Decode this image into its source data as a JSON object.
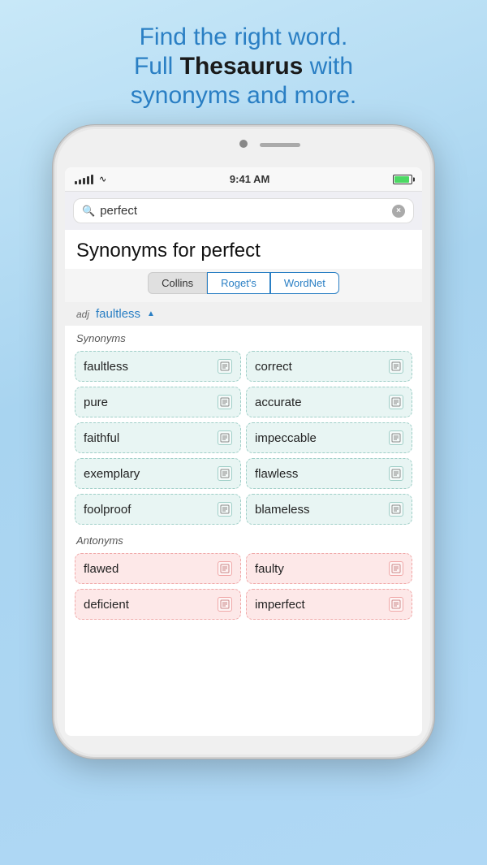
{
  "header": {
    "line1": "Find the right word.",
    "line2_plain": "Full ",
    "line2_bold": "Thesaurus",
    "line2_rest": " with",
    "line3": "synonyms and more."
  },
  "status_bar": {
    "time": "9:41 AM",
    "signal": "●●●●●",
    "wifi": "WiFi"
  },
  "search": {
    "placeholder": "Search",
    "value": "perfect",
    "clear_label": "×"
  },
  "content": {
    "title": "Synonyms for perfect",
    "tabs": [
      {
        "label": "Collins",
        "style": "gray"
      },
      {
        "label": "Roget's",
        "style": "blue"
      },
      {
        "label": "WordNet",
        "style": "blue"
      }
    ],
    "section_pos": "adj",
    "section_word": "faultless",
    "synonyms_label": "Synonyms",
    "synonyms": [
      {
        "word": "faultless"
      },
      {
        "word": "correct"
      },
      {
        "word": "pure"
      },
      {
        "word": "accurate"
      },
      {
        "word": "faithful"
      },
      {
        "word": "impeccable"
      },
      {
        "word": "exemplary"
      },
      {
        "word": "flawless"
      },
      {
        "word": "foolproof"
      },
      {
        "word": "blameless"
      }
    ],
    "antonyms_label": "Antonyms",
    "antonyms": [
      {
        "word": "flawed"
      },
      {
        "word": "faulty"
      },
      {
        "word": "deficient"
      },
      {
        "word": "imperfect"
      }
    ]
  }
}
